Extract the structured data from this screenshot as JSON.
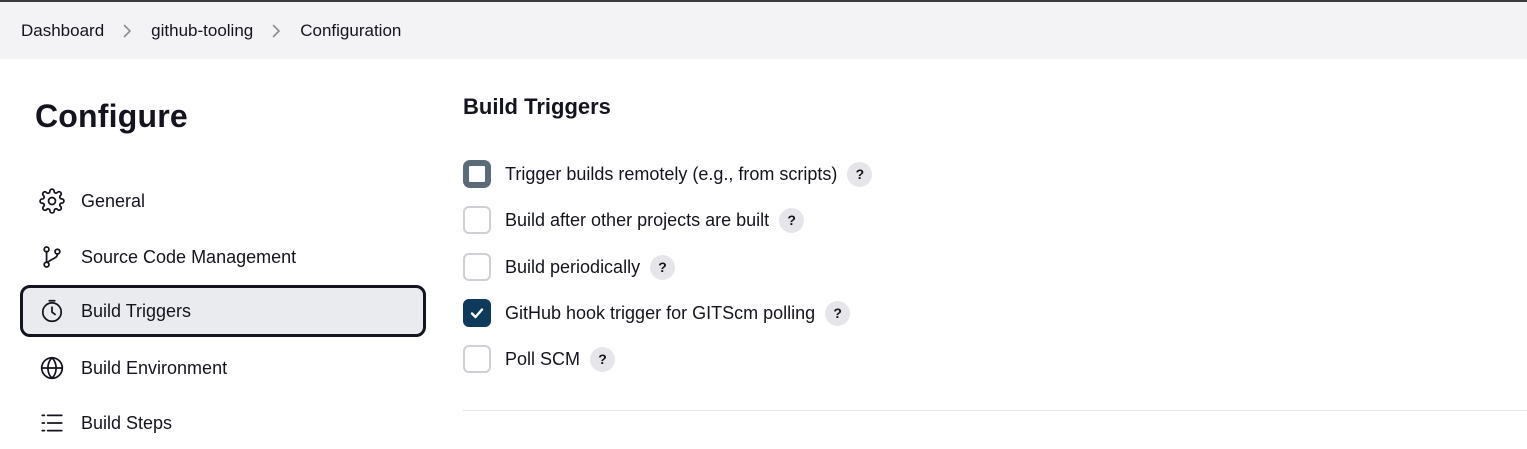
{
  "breadcrumb": {
    "items": [
      "Dashboard",
      "github-tooling",
      "Configuration"
    ]
  },
  "page": {
    "title": "Configure"
  },
  "sidebar": {
    "items": [
      {
        "label": "General",
        "icon": "gear-icon"
      },
      {
        "label": "Source Code Management",
        "icon": "git-branch-icon"
      },
      {
        "label": "Build Triggers",
        "icon": "timer-icon",
        "active": true
      },
      {
        "label": "Build Environment",
        "icon": "globe-icon"
      },
      {
        "label": "Build Steps",
        "icon": "list-icon"
      }
    ]
  },
  "build_triggers": {
    "title": "Build Triggers",
    "options": [
      {
        "label": "Trigger builds remotely (e.g., from scripts)",
        "checked": false,
        "focused": true,
        "help": "?"
      },
      {
        "label": "Build after other projects are built",
        "checked": false,
        "help": "?"
      },
      {
        "label": "Build periodically",
        "checked": false,
        "help": "?"
      },
      {
        "label": "GitHub hook trigger for GITScm polling",
        "checked": true,
        "help": "?"
      },
      {
        "label": "Poll SCM",
        "checked": false,
        "help": "?"
      }
    ]
  },
  "colors": {
    "accent": "#0f3a5c",
    "breadcrumb_bg": "#f3f3f5",
    "active_item_bg": "#eaebef"
  }
}
